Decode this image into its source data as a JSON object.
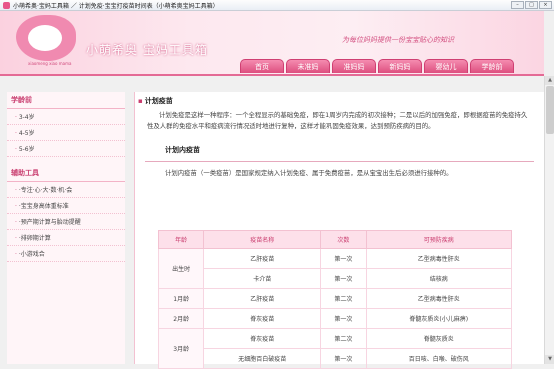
{
  "window": {
    "title": "小萌希奥·宝妈工具箱 ／ 计划免疫·宝宝打疫苗时间表（小萌希奥宝妈工具箱）",
    "minimize": "–",
    "maximize": "□",
    "close": "×"
  },
  "header": {
    "logo_text": "小萌希奥 宝妈工具箱",
    "logo_sub": "xiaomeng xiao mama",
    "slogan": "为每位妈妈提供一份宝宝贴心的知识"
  },
  "nav": {
    "tabs": [
      "首页",
      "未准妈",
      "准妈妈",
      "新妈妈",
      "婴幼儿",
      "学龄前"
    ]
  },
  "sidebar": {
    "sections": [
      {
        "title": "学龄前",
        "items": [
          "3-4岁",
          "4-5岁",
          "5-6岁"
        ]
      },
      {
        "title": "辅助工具",
        "items": [
          "·专注·心·大·数·机·会",
          "·宝宝身高体重标准",
          "·预产期计算与胎动提醒",
          "·排卵期计算",
          "·小游戏合"
        ]
      }
    ]
  },
  "main": {
    "heading": "计划疫苗",
    "intro": "计划免疫是这样一种程序：一个全程显示的基础免疫，即在1周岁内完成的初次接种；二是以后的加强免疫，即根据疫苗的免疫持久性及人群的免疫水平和疫病流行情况适时地进行复种，这样才能巩固免疫效果，达到预防疾病的目的。",
    "subheading": "计划内疫苗",
    "desc": "计划内疫苗（一类疫苗）是国家规定纳入计划免疫、属于免费疫苗，是从宝宝出生后必须进行接种的。",
    "table": {
      "headers": [
        "年龄",
        "疫苗名称",
        "次数",
        "可预防疾病"
      ],
      "rows": [
        {
          "age": "出生时",
          "vaccine": "乙肝疫苗",
          "times": "第一次",
          "disease": "乙型病毒性肝炎"
        },
        {
          "age": "",
          "vaccine": "卡介苗",
          "times": "第一次",
          "disease": "结核病"
        },
        {
          "age": "1月龄",
          "vaccine": "乙肝疫苗",
          "times": "第二次",
          "disease": "乙型病毒性肝炎"
        },
        {
          "age": "2月龄",
          "vaccine": "脊灰疫苗",
          "times": "第一次",
          "disease": "脊髓灰质炎(小儿麻痹)"
        },
        {
          "age": "3月龄",
          "vaccine": "脊灰疫苗",
          "times": "第二次",
          "disease": "脊髓灰质炎"
        },
        {
          "age": "",
          "vaccine": "无细胞百白破疫苗",
          "times": "第一次",
          "disease": "百日咳、白喉、破伤风"
        }
      ]
    }
  },
  "scrollbar": {
    "up": "▲",
    "down": "▼"
  }
}
